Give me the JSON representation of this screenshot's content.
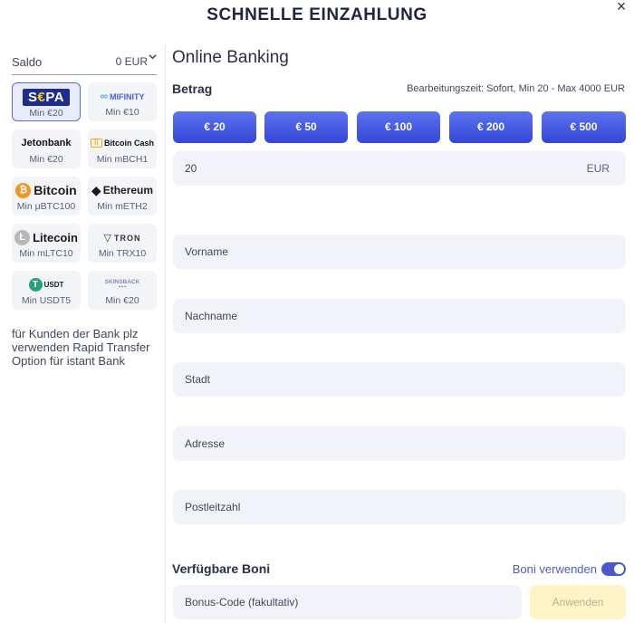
{
  "modal": {
    "title": "SCHNELLE EINZAHLUNG",
    "close_symbol": "×"
  },
  "sidebar": {
    "saldo_label": "Saldo",
    "saldo_value": "0 EUR",
    "methods": [
      {
        "name": "SEPA",
        "min": "Min €20",
        "active": true
      },
      {
        "name": "MIFINITY",
        "min": "Min €10"
      },
      {
        "name": "Jetonbank",
        "min": "Min €20"
      },
      {
        "name": "Bitcoin Cash",
        "min": "Min mBCH1"
      },
      {
        "name": "Bitcoin",
        "min": "Min μBTC100"
      },
      {
        "name": "Ethereum",
        "min": "Min mETH2"
      },
      {
        "name": "Litecoin",
        "min": "Min mLTC10"
      },
      {
        "name": "TRON",
        "min": "Min TRX10"
      },
      {
        "name": "USDT",
        "min": "Min USDT5"
      },
      {
        "name": "SKINSBACK",
        "min": "Min €20"
      }
    ],
    "note": "für Kunden der Bank plz verwenden Rapid Transfer Option für istant Bank"
  },
  "main": {
    "section_title": "Online Banking",
    "betrag_label": "Betrag",
    "processing_info": "Bearbeitungszeit: Sofort, Min 20 - Max 4000 EUR",
    "amounts": [
      "€ 20",
      "€ 50",
      "€ 100",
      "€ 200",
      "€ 500"
    ],
    "amount_value": "20",
    "currency": "EUR",
    "fields": {
      "vorname": "Vorname",
      "nachname": "Nachname",
      "stadt": "Stadt",
      "adresse": "Adresse",
      "postleitzahl": "Postleitzahl"
    },
    "boni_title": "Verfügbare Boni",
    "boni_toggle_label": "Boni verwenden",
    "bonus_code_placeholder": "Bonus-Code (fakultativ)",
    "apply_label": "Anwenden"
  },
  "colors": {
    "primary_button": "#3f52e0",
    "apply_button_bg": "#fdf3c4",
    "toggle_on": "#4a58d0",
    "field_bg": "#f2f3f8"
  }
}
